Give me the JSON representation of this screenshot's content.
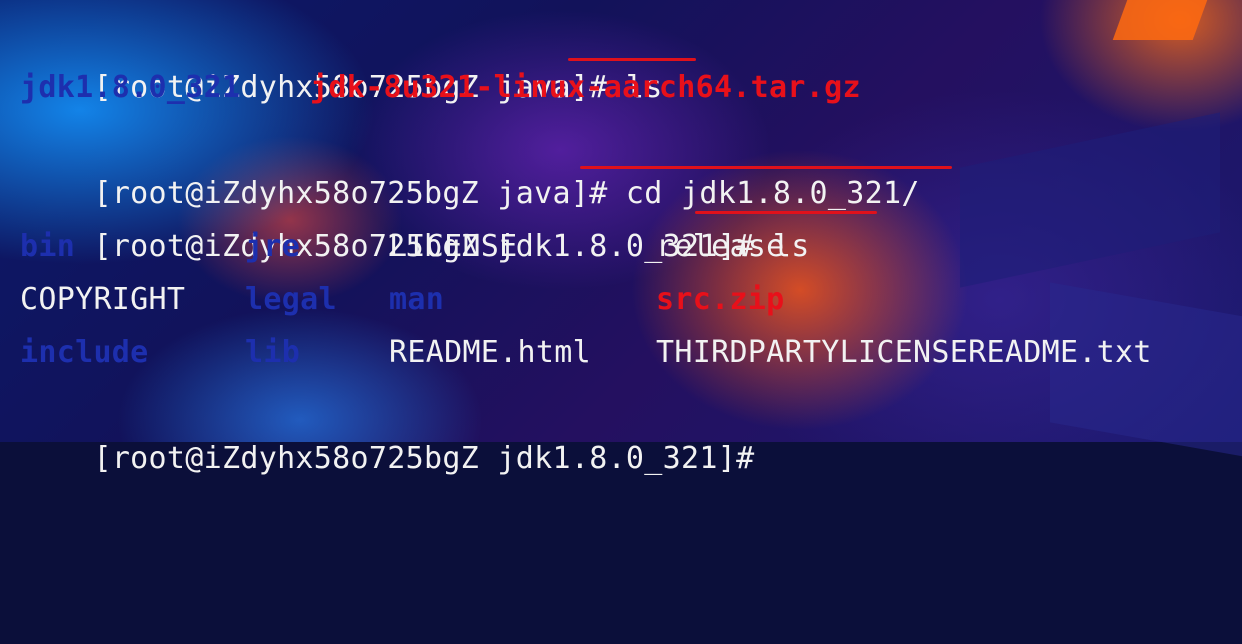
{
  "terminal": {
    "prompt1": "[root@iZdyhx58o725bgZ java]# ls",
    "ls1": [
      "jdk1.8.0_321",
      "jdk-8u321-linux-aarch64.tar.gz"
    ],
    "prompt2": "[root@iZdyhx58o725bgZ java]# cd jdk1.8.0_321/",
    "prompt3": "[root@iZdyhx58o725bgZ jdk1.8.0_321]# ls",
    "listing": [
      [
        "bin",
        "jre",
        "LICENSE",
        "release"
      ],
      [
        "COPYRIGHT",
        "legal",
        "man",
        "src.zip"
      ],
      [
        "include",
        "lib",
        "README.html",
        "THIRDPARTYLICENSEREADME.txt"
      ]
    ],
    "prompt4": "[root@iZdyhx58o725bgZ jdk1.8.0_321]#"
  },
  "colors": {
    "directory": "#1d2fae",
    "archive": "#e8101a",
    "text": "#f2f2f2",
    "annotation": "#e0111b"
  }
}
